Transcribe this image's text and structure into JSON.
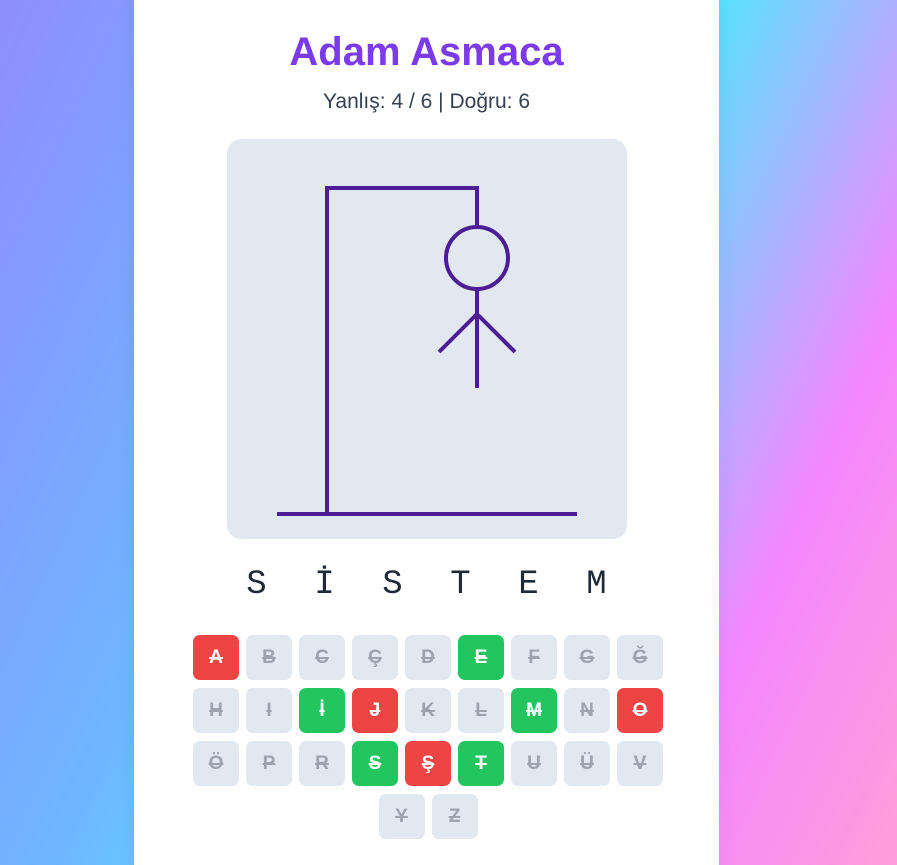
{
  "title": "Adam Asmaca",
  "status": {
    "wrong_label": "Yanlış:",
    "wrong_value": "4 / 6",
    "separator": "|",
    "correct_label": "Doğru:",
    "correct_value": "6"
  },
  "game": {
    "wrong_guesses": 4,
    "max_wrong": 6,
    "drawn_parts": [
      "head",
      "body",
      "left-arm",
      "right-arm"
    ]
  },
  "word": [
    "S",
    "İ",
    "S",
    "T",
    "E",
    "M"
  ],
  "keyboard": [
    {
      "letter": "A",
      "state": "wrong"
    },
    {
      "letter": "B",
      "state": "disabled"
    },
    {
      "letter": "C",
      "state": "disabled"
    },
    {
      "letter": "Ç",
      "state": "disabled"
    },
    {
      "letter": "D",
      "state": "disabled"
    },
    {
      "letter": "E",
      "state": "correct"
    },
    {
      "letter": "F",
      "state": "disabled"
    },
    {
      "letter": "G",
      "state": "disabled"
    },
    {
      "letter": "Ğ",
      "state": "disabled"
    },
    {
      "letter": "H",
      "state": "disabled"
    },
    {
      "letter": "I",
      "state": "disabled"
    },
    {
      "letter": "İ",
      "state": "correct"
    },
    {
      "letter": "J",
      "state": "wrong"
    },
    {
      "letter": "K",
      "state": "disabled"
    },
    {
      "letter": "L",
      "state": "disabled"
    },
    {
      "letter": "M",
      "state": "correct"
    },
    {
      "letter": "N",
      "state": "disabled"
    },
    {
      "letter": "O",
      "state": "wrong"
    },
    {
      "letter": "Ö",
      "state": "disabled"
    },
    {
      "letter": "P",
      "state": "disabled"
    },
    {
      "letter": "R",
      "state": "disabled"
    },
    {
      "letter": "S",
      "state": "correct"
    },
    {
      "letter": "Ş",
      "state": "wrong"
    },
    {
      "letter": "T",
      "state": "correct"
    },
    {
      "letter": "U",
      "state": "disabled"
    },
    {
      "letter": "Ü",
      "state": "disabled"
    },
    {
      "letter": "V",
      "state": "disabled"
    },
    {
      "letter": "Y",
      "state": "disabled"
    },
    {
      "letter": "Z",
      "state": "disabled"
    }
  ],
  "colors": {
    "accent": "#7c3aed",
    "gallows": "#4c1d95",
    "correct": "#22c55e",
    "wrong": "#ef4444",
    "disabled": "#e2e8f0"
  }
}
